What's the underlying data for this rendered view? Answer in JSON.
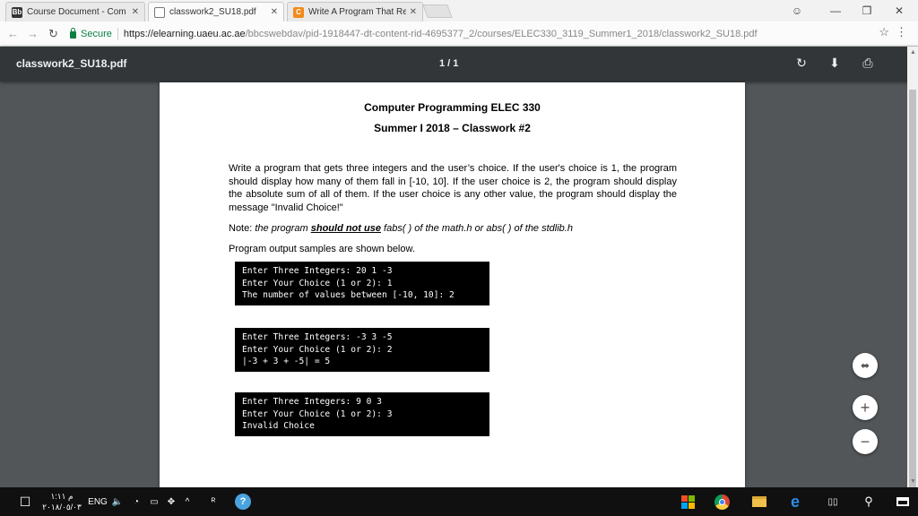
{
  "tabs": [
    {
      "label": "Course Document - Com",
      "favicon": "Bb",
      "active": false
    },
    {
      "label": "classwork2_SU18.pdf",
      "favicon": "doc",
      "active": true
    },
    {
      "label": "Write A Program That Re",
      "favicon": "C",
      "active": false
    }
  ],
  "window_controls": {
    "profile": "☺",
    "minimize": "—",
    "restore": "❒",
    "close": "✕"
  },
  "nav": {
    "back": "←",
    "forward": "→",
    "reload": "↻"
  },
  "omnibox": {
    "secure_label": "Secure",
    "url_host": "https://elearning.uaeu.ac.ae",
    "url_path": "/bbcswebdav/pid-1918447-dt-content-rid-4695377_2/courses/ELEC330_3119_Summer1_2018/classwork2_SU18.pdf"
  },
  "pdf_toolbar": {
    "filename": "classwork2_SU18.pdf",
    "page_indicator": "1 / 1",
    "rotate_icon": "↻",
    "download_icon": "⬇",
    "print_icon": "⎙"
  },
  "document": {
    "course_title": "Computer Programming ELEC 330",
    "subtitle": "Summer I 2018 – Classwork #2",
    "problem": "Write a program that gets three integers and the user’s choice. If the user's choice is 1, the program should display how many of them fall in [-10, 10]. If the user choice is 2, the program should display the absolute sum of all of them. If the user choice is any other value, the program should display the message \"Invalid Choice!\"",
    "note_prefix": "Note: ",
    "note_part1": "the program ",
    "note_emph": "should not use",
    "note_part2": " fabs( ) of the math.h or abs( ) of the stdlib.h",
    "output_intro": "Program output samples are shown below.",
    "samples": [
      [
        "Enter Three Integers: 20 1 -3",
        "Enter Your Choice (1 or 2): 1",
        "The number of values between [-10, 10]: 2"
      ],
      [
        "Enter Three Integers: -3 3 -5",
        "Enter Your Choice (1 or 2): 2",
        "|-3 + 3 + -5| = 5"
      ],
      [
        "Enter Three Integers: 9 0 3",
        "Enter Your Choice (1 or 2): 3",
        "Invalid Choice"
      ]
    ]
  },
  "zoom": {
    "fit": "⬌",
    "zoom_in": "+",
    "zoom_out": "−"
  },
  "taskbar": {
    "time": "م ١:١١",
    "date": "٢٠١٨/٠٥/٠٣",
    "language": "ENG"
  }
}
